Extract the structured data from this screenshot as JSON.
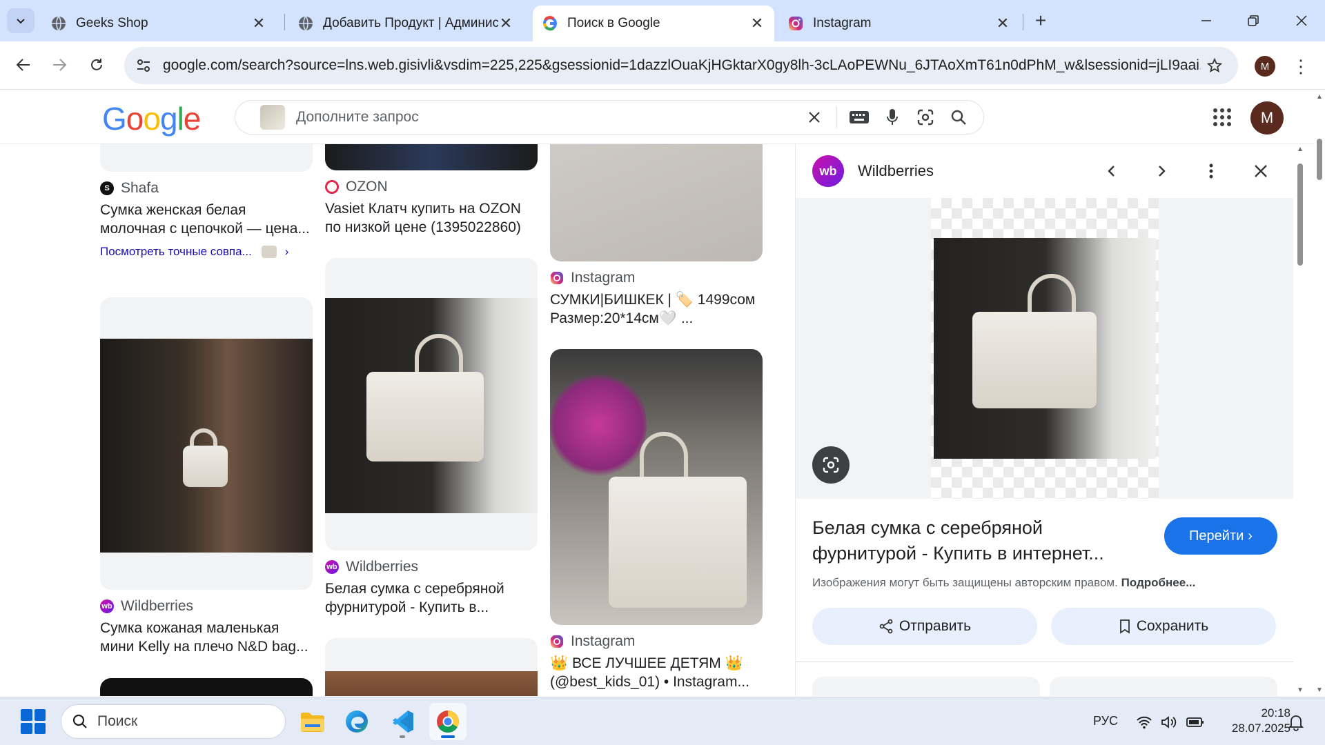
{
  "browser": {
    "tabs": [
      {
        "title": "Geeks Shop",
        "icon": "globe-icon"
      },
      {
        "title": "Добавить Продукт | Администрирование",
        "icon": "globe-icon"
      },
      {
        "title": "Поиск в Google",
        "icon": "google-icon",
        "active": true
      },
      {
        "title": "Instagram",
        "icon": "instagram-icon"
      }
    ],
    "url": "google.com/search?source=lns.web.gisivli&vsdim=225,225&gsessionid=1dazzlOuaKjHGktarX0gy8lh-3cLAoPEWNu_6JTAoXmT61n0dPhM_w&lsessionid=jLI9aai...",
    "profile_initial": "M"
  },
  "google": {
    "logo_letters": [
      "G",
      "o",
      "o",
      "g",
      "l",
      "e"
    ],
    "logo_colors": [
      "#4285F4",
      "#EA4335",
      "#FBBC05",
      "#4285F4",
      "#34A853",
      "#EA4335"
    ],
    "search_placeholder": "Дополните запрос",
    "avatar_initial": "M"
  },
  "results": {
    "col1": [
      {
        "source": "Shafa",
        "title": "Сумка женская белая молочная с цепочкой — цена...",
        "exact_link": "Посмотреть точные совпа..."
      },
      {
        "source": "Wildberries",
        "title": "Сумка кожаная маленькая мини Kelly на плечо N&D bag..."
      }
    ],
    "col2": [
      {
        "source": "OZON",
        "title": "Vasiet Клатч купить на OZON по низкой цене (1395022860)"
      },
      {
        "source": "Wildberries",
        "title": "Белая сумка с серебряной фурнитурой - Купить в..."
      }
    ],
    "col3": [
      {
        "source": "Instagram",
        "title": "СУМКИ|БИШКЕК | 🏷️ 1499сом Размер:20*14см🤍 ..."
      },
      {
        "source": "Instagram",
        "title": "👑 ВСЕ ЛУЧШЕЕ ДЕТЯМ 👑 (@best_kids_01) • Instagram..."
      }
    ]
  },
  "panel": {
    "site": "Wildberries",
    "site_logo_text": "wb",
    "title": "Белая сумка с серебряной фурнитурой - Купить в интернет...",
    "goto_label": "Перейти",
    "copyright_text": "Изображения могут быть защищены авторским правом.",
    "copyright_more": "Подробнее...",
    "share_label": "Отправить",
    "save_label": "Сохранить"
  },
  "taskbar": {
    "search_label": "Поиск",
    "language": "РУС",
    "time": "20:18",
    "date": "28.07.2025"
  }
}
